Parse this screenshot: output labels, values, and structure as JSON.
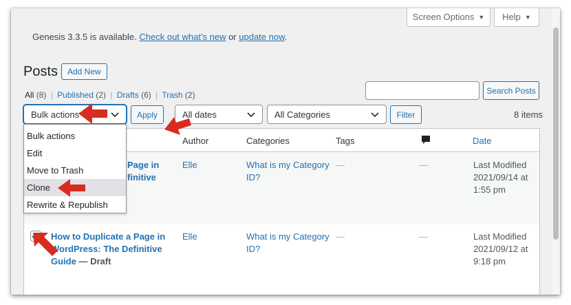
{
  "header": {
    "screen_options": "Screen Options",
    "help": "Help"
  },
  "notice": {
    "text": "Genesis 3.3.5 is available.",
    "link1": "Check out what's new",
    "or": "or",
    "link2": "update now",
    "period": "."
  },
  "page": {
    "title": "Posts",
    "add_new": "Add New"
  },
  "views": [
    {
      "label": "All",
      "count": "(8)"
    },
    {
      "label": "Published",
      "count": "(2)"
    },
    {
      "label": "Drafts",
      "count": "(6)"
    },
    {
      "label": "Trash",
      "count": "(2)"
    }
  ],
  "search": {
    "placeholder": "",
    "button": "Search Posts"
  },
  "filters": {
    "bulk_selected": "Bulk actions",
    "apply": "Apply",
    "dates": "All dates",
    "categories": "All Categories",
    "filter": "Filter",
    "items": "8 items"
  },
  "bulk_menu": [
    "Bulk actions",
    "Edit",
    "Move to Trash",
    "Clone",
    "Rewrite & Republish"
  ],
  "table": {
    "columns": {
      "author": "Author",
      "categories": "Categories",
      "tags": "Tags",
      "comments_icon": "comment-bubble-icon",
      "date": "Date"
    },
    "rows": [
      {
        "title_l1": "Page in",
        "title_l2": "finitive",
        "author": "Elle",
        "cat_l1": "What is my Category",
        "cat_l2": "ID?",
        "tags": "—",
        "comments": "—",
        "date_l1": "Last Modified",
        "date_l2": "2021/09/14 at",
        "date_l3": "1:55 pm"
      },
      {
        "checked": true,
        "title_l1": "How to Duplicate a Page in",
        "title_l2": "WordPress: The Definitive",
        "title_l3": "Guide",
        "state": " — Draft",
        "author": "Elle",
        "cat_l1": "What is my Category",
        "cat_l2": "ID?",
        "tags": "—",
        "comments": "—",
        "date_l1": "Last Modified",
        "date_l2": "2021/09/12 at",
        "date_l3": "9:18 pm"
      }
    ]
  },
  "colors": {
    "link": "#2271b1",
    "annotation_arrow": "#d62d20",
    "background": "#f0f0f1"
  }
}
